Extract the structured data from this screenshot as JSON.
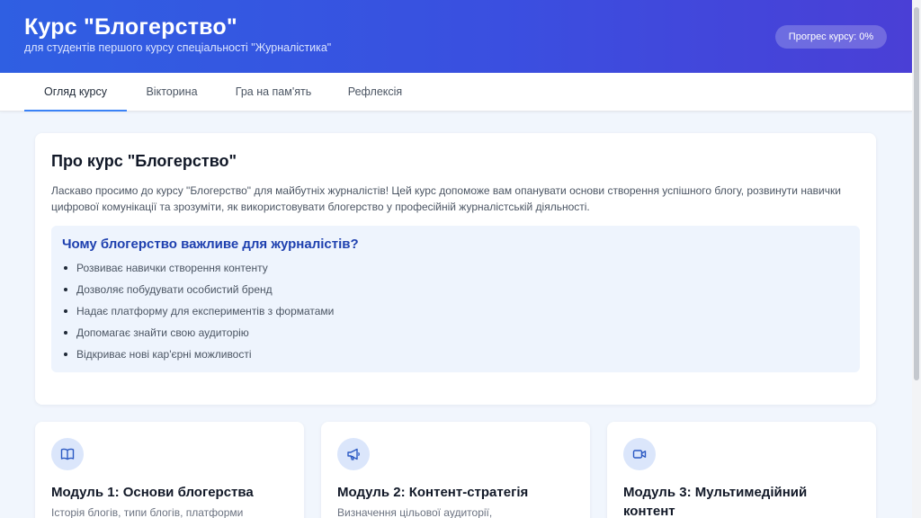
{
  "header": {
    "title": "Курс \"Блогерство\"",
    "subtitle": "для студентів першого курсу спеціальності \"Журналістика\"",
    "progress": "Прогрес курсу: 0%"
  },
  "tabs": [
    {
      "label": "Огляд курсу",
      "active": true
    },
    {
      "label": "Вікторина",
      "active": false
    },
    {
      "label": "Гра на пам'ять",
      "active": false
    },
    {
      "label": "Рефлексія",
      "active": false
    }
  ],
  "about": {
    "title": "Про курс \"Блогерство\"",
    "text": "Ласкаво просимо до курсу \"Блогерство\" для майбутніх журналістів! Цей курс допоможе вам опанувати основи створення успішного блогу, розвинути навички цифрової комунікації та зрозуміти, як використовувати блогерство у професійній журналістській діяльності.",
    "why_title": "Чому блогерство важливе для журналістів?",
    "why_items": [
      "Розвиває навички створення контенту",
      "Дозволяє побудувати особистий бренд",
      "Надає платформу для експериментів з форматами",
      "Допомагає знайти свою аудиторію",
      "Відкриває нові кар'єрні можливості"
    ]
  },
  "modules": [
    {
      "icon": "book-icon",
      "title": "Модуль 1: Основи блогерства",
      "desc": "Історія блогів, типи блогів, платформи"
    },
    {
      "icon": "megaphone-icon",
      "title": "Модуль 2: Контент-стратегія",
      "desc": "Визначення цільової аудиторії,"
    },
    {
      "icon": "video-camera-icon",
      "title": "Модуль 3: Мультимедійний контент",
      "desc": ""
    }
  ],
  "colors": {
    "header_start": "#2f5fe2",
    "header_end": "#4a3fd6",
    "accent": "#3b82f6",
    "why_title": "#1e40af",
    "icon_bg": "#dbe6fb"
  }
}
